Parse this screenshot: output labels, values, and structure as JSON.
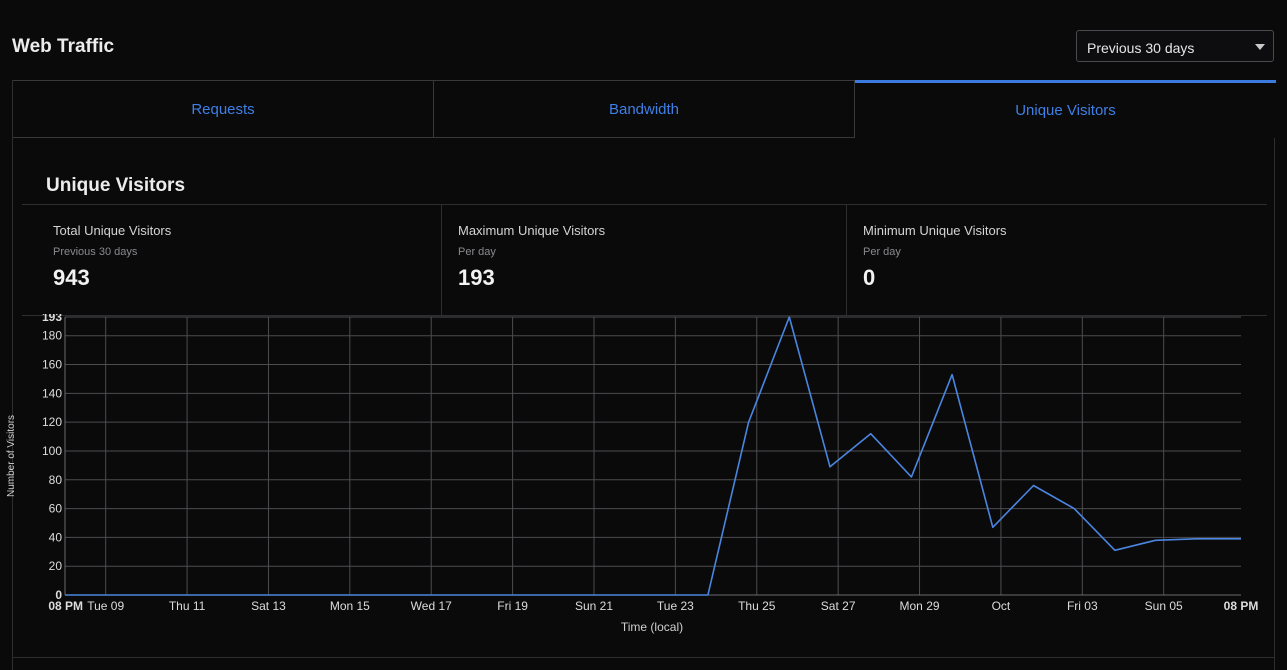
{
  "header": {
    "title": "Web Traffic",
    "range_select": {
      "value": "Previous 30 days"
    }
  },
  "tabs": [
    {
      "label": "Requests",
      "active": false
    },
    {
      "label": "Bandwidth",
      "active": false
    },
    {
      "label": "Unique Visitors",
      "active": true
    }
  ],
  "section": {
    "title": "Unique Visitors"
  },
  "stats": [
    {
      "label": "Total Unique Visitors",
      "sub": "Previous 30 days",
      "value": "943"
    },
    {
      "label": "Maximum Unique Visitors",
      "sub": "Per day",
      "value": "193"
    },
    {
      "label": "Minimum Unique Visitors",
      "sub": "Per day",
      "value": "0"
    }
  ],
  "colors": {
    "accent": "#3f7fe6",
    "line": "#4a86e0",
    "grid": "#4d4d50",
    "background": "#0a0a0b"
  },
  "chart_data": {
    "type": "line",
    "ylabel": "Number of Visitors",
    "xlabel": "Time (local)",
    "ylim": [
      0,
      193
    ],
    "y_ticks": [
      0,
      20,
      40,
      60,
      80,
      100,
      120,
      140,
      160,
      180,
      193
    ],
    "grid": true,
    "x_ticks": [
      {
        "day": 0,
        "label": "08 PM",
        "bold": true
      },
      {
        "day": 1,
        "label": "Tue 09"
      },
      {
        "day": 3,
        "label": "Thu 11"
      },
      {
        "day": 5,
        "label": "Sat 13"
      },
      {
        "day": 7,
        "label": "Mon 15"
      },
      {
        "day": 9,
        "label": "Wed 17"
      },
      {
        "day": 11,
        "label": "Fri 19"
      },
      {
        "day": 13,
        "label": "Sun 21"
      },
      {
        "day": 15,
        "label": "Tue 23"
      },
      {
        "day": 17,
        "label": "Thu 25"
      },
      {
        "day": 19,
        "label": "Sat 27"
      },
      {
        "day": 21,
        "label": "Mon 29"
      },
      {
        "day": 23,
        "label": "Oct"
      },
      {
        "day": 25,
        "label": "Fri 03"
      },
      {
        "day": 27,
        "label": "Sun 05"
      },
      {
        "day": 28.9,
        "label": "08 PM",
        "bold": true
      }
    ],
    "x_range": [
      0,
      28.9
    ],
    "series": [
      {
        "points": [
          [
            0,
            0
          ],
          [
            15.8,
            0
          ],
          [
            16.8,
            120
          ],
          [
            17.8,
            193
          ],
          [
            18.8,
            89
          ],
          [
            19.8,
            112
          ],
          [
            20.8,
            82
          ],
          [
            21.8,
            153
          ],
          [
            22.8,
            47
          ],
          [
            23.8,
            76
          ],
          [
            24.8,
            60
          ],
          [
            25.8,
            31
          ],
          [
            26.8,
            38
          ],
          [
            27.8,
            39
          ],
          [
            28.9,
            39
          ]
        ]
      }
    ]
  }
}
